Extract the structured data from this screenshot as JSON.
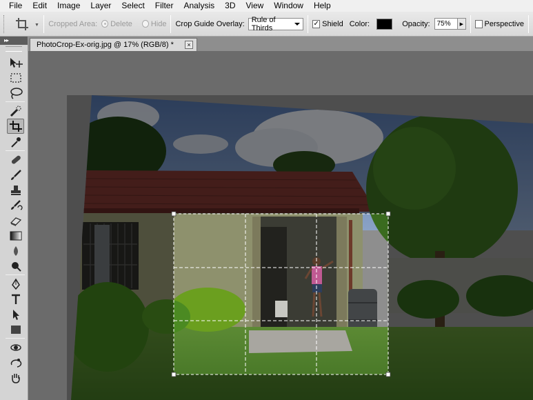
{
  "menu": [
    "File",
    "Edit",
    "Image",
    "Layer",
    "Select",
    "Filter",
    "Analysis",
    "3D",
    "View",
    "Window",
    "Help"
  ],
  "options": {
    "cropped_area_label": "Cropped Area:",
    "delete_label": "Delete",
    "hide_label": "Hide",
    "guide_overlay_label": "Crop Guide Overlay:",
    "guide_overlay_value": "Rule of Thirds",
    "shield_label": "Shield",
    "shield_checked": true,
    "color_label": "Color:",
    "shield_color": "#000000",
    "opacity_label": "Opacity:",
    "opacity_value": "75%",
    "perspective_label": "Perspective",
    "perspective_checked": false
  },
  "toolbox": {
    "collapse_glyph": "▸▸",
    "active_tool": "crop-tool",
    "tools": [
      "move-tool",
      "marquee-tool",
      "lasso-tool",
      "quick-selection-tool",
      "crop-tool",
      "eyedropper-tool",
      "spot-healing-tool",
      "brush-tool",
      "clone-stamp-tool",
      "history-brush-tool",
      "eraser-tool",
      "gradient-tool",
      "blur-tool",
      "dodge-tool",
      "pen-tool",
      "type-tool",
      "path-selection-tool",
      "rectangle-tool",
      "3d-rotate-tool",
      "3d-orbit-tool",
      "hand-tool"
    ]
  },
  "document": {
    "tab_title": "PhotoCrop-Ex-orig.jpg @ 17% (RGB/8) *",
    "close_glyph": "×"
  },
  "colors": {
    "sky": "#6d88b4",
    "roof": "#8a3e35",
    "wall": "#a4a77f",
    "grass": "#4d7a2c",
    "shield": "#000000"
  }
}
